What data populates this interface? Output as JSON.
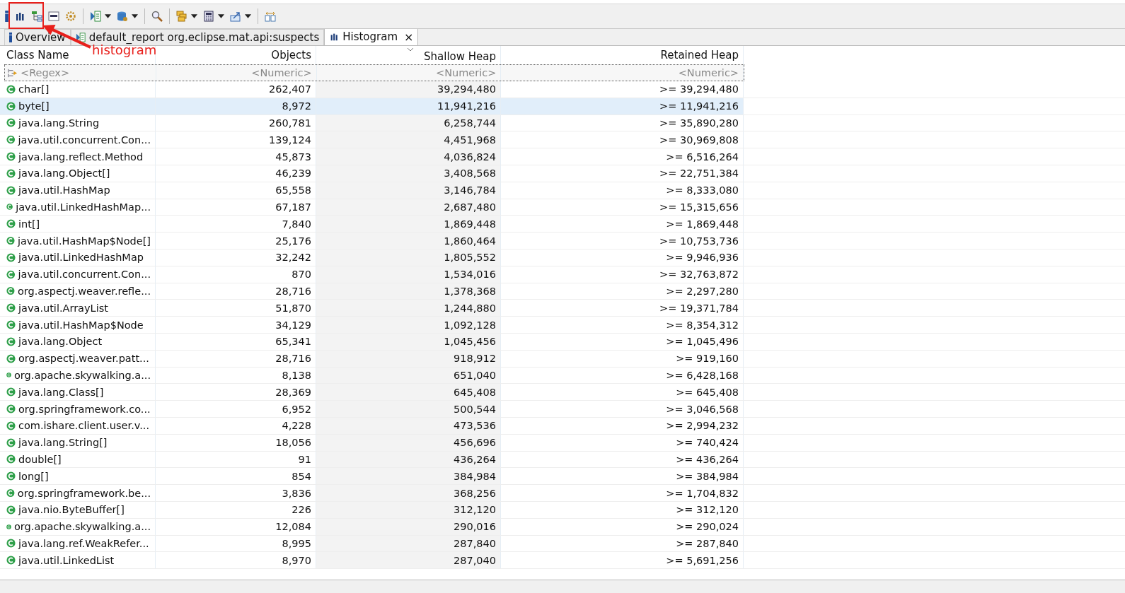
{
  "toolbar": {
    "buttons": [
      {
        "kind": "info"
      },
      {
        "kind": "histogram"
      },
      {
        "kind": "tree"
      },
      {
        "kind": "oql"
      },
      {
        "kind": "gear"
      },
      {
        "kind": "report",
        "dropdown": true
      },
      {
        "kind": "database",
        "dropdown": true
      },
      {
        "kind": "search"
      },
      {
        "kind": "group",
        "dropdown": true
      },
      {
        "kind": "calculator",
        "dropdown": true
      },
      {
        "kind": "export",
        "dropdown": true
      },
      {
        "kind": "layout"
      }
    ]
  },
  "annotation": {
    "label": "histogram"
  },
  "tabs": [
    {
      "kind": "info",
      "label": "Overview",
      "selected": false,
      "closable": false
    },
    {
      "kind": "report",
      "label": "default_report  org.eclipse.mat.api:suspects",
      "selected": false,
      "closable": false
    },
    {
      "kind": "histogram",
      "label": "Histogram",
      "selected": true,
      "closable": true,
      "close": "×"
    }
  ],
  "table": {
    "columns": [
      {
        "label": "Class Name",
        "filter": "<Regex>",
        "sorted": false
      },
      {
        "label": "Objects",
        "filter": "<Numeric>",
        "sorted": false
      },
      {
        "label": "Shallow Heap",
        "filter": "<Numeric>",
        "sorted": true
      },
      {
        "label": "Retained Heap",
        "filter": "<Numeric>",
        "sorted": false
      }
    ],
    "rows": [
      {
        "cells": [
          "char[]",
          "262,407",
          "39,294,480",
          ">= 39,294,480"
        ],
        "selected": false
      },
      {
        "cells": [
          "byte[]",
          "8,972",
          "11,941,216",
          ">= 11,941,216"
        ],
        "selected": true
      },
      {
        "cells": [
          "java.lang.String",
          "260,781",
          "6,258,744",
          ">= 35,890,280"
        ],
        "selected": false
      },
      {
        "cells": [
          "java.util.concurrent.Con...",
          "139,124",
          "4,451,968",
          ">= 30,969,808"
        ],
        "selected": false
      },
      {
        "cells": [
          "java.lang.reflect.Method",
          "45,873",
          "4,036,824",
          ">= 6,516,264"
        ],
        "selected": false
      },
      {
        "cells": [
          "java.lang.Object[]",
          "46,239",
          "3,408,568",
          ">= 22,751,384"
        ],
        "selected": false
      },
      {
        "cells": [
          "java.util.HashMap",
          "65,558",
          "3,146,784",
          ">= 8,333,080"
        ],
        "selected": false
      },
      {
        "cells": [
          "java.util.LinkedHashMap...",
          "67,187",
          "2,687,480",
          ">= 15,315,656"
        ],
        "selected": false
      },
      {
        "cells": [
          "int[]",
          "7,840",
          "1,869,448",
          ">= 1,869,448"
        ],
        "selected": false
      },
      {
        "cells": [
          "java.util.HashMap$Node[]",
          "25,176",
          "1,860,464",
          ">= 10,753,736"
        ],
        "selected": false
      },
      {
        "cells": [
          "java.util.LinkedHashMap",
          "32,242",
          "1,805,552",
          ">= 9,946,936"
        ],
        "selected": false
      },
      {
        "cells": [
          "java.util.concurrent.Con...",
          "870",
          "1,534,016",
          ">= 32,763,872"
        ],
        "selected": false
      },
      {
        "cells": [
          "org.aspectj.weaver.refle...",
          "28,716",
          "1,378,368",
          ">= 2,297,280"
        ],
        "selected": false
      },
      {
        "cells": [
          "java.util.ArrayList",
          "51,870",
          "1,244,880",
          ">= 19,371,784"
        ],
        "selected": false
      },
      {
        "cells": [
          "java.util.HashMap$Node",
          "34,129",
          "1,092,128",
          ">= 8,354,312"
        ],
        "selected": false
      },
      {
        "cells": [
          "java.lang.Object",
          "65,341",
          "1,045,456",
          ">= 1,045,496"
        ],
        "selected": false
      },
      {
        "cells": [
          "org.aspectj.weaver.patt...",
          "28,716",
          "918,912",
          ">= 919,160"
        ],
        "selected": false
      },
      {
        "cells": [
          "org.apache.skywalking.a...",
          "8,138",
          "651,040",
          ">= 6,428,168"
        ],
        "selected": false
      },
      {
        "cells": [
          "java.lang.Class[]",
          "28,369",
          "645,408",
          ">= 645,408"
        ],
        "selected": false
      },
      {
        "cells": [
          "org.springframework.co...",
          "6,952",
          "500,544",
          ">= 3,046,568"
        ],
        "selected": false
      },
      {
        "cells": [
          "com.ishare.client.user.v...",
          "4,228",
          "473,536",
          ">= 2,994,232"
        ],
        "selected": false
      },
      {
        "cells": [
          "java.lang.String[]",
          "18,056",
          "456,696",
          ">= 740,424"
        ],
        "selected": false
      },
      {
        "cells": [
          "double[]",
          "91",
          "436,264",
          ">= 436,264"
        ],
        "selected": false
      },
      {
        "cells": [
          "long[]",
          "854",
          "384,984",
          ">= 384,984"
        ],
        "selected": false
      },
      {
        "cells": [
          "org.springframework.be...",
          "3,836",
          "368,256",
          ">= 1,704,832"
        ],
        "selected": false
      },
      {
        "cells": [
          "java.nio.ByteBuffer[]",
          "226",
          "312,120",
          ">= 312,120"
        ],
        "selected": false
      },
      {
        "cells": [
          "org.apache.skywalking.a...",
          "12,084",
          "290,016",
          ">= 290,024"
        ],
        "selected": false
      },
      {
        "cells": [
          "java.lang.ref.WeakRefer...",
          "8,995",
          "287,840",
          ">= 287,840"
        ],
        "selected": false
      },
      {
        "cells": [
          "java.util.LinkedList",
          "8,970",
          "287,040",
          ">= 5,691,256"
        ],
        "selected": false
      }
    ]
  }
}
